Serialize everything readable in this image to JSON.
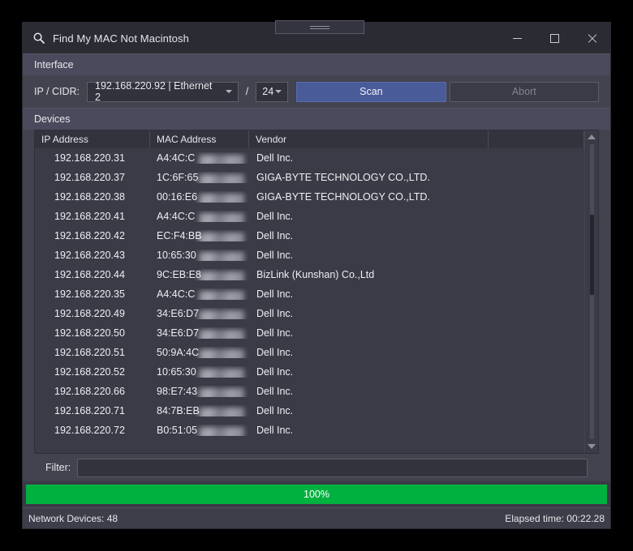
{
  "window": {
    "title": "Find My MAC Not Macintosh",
    "title_icon": "magnifier-icon",
    "minimize_label": "Minimize",
    "maximize_label": "Maximize",
    "close_label": "Close"
  },
  "interface_group": {
    "header": "Interface",
    "ip_cidr_label": "IP / CIDR:",
    "ip_value": "192.168.220.92 | Ethernet 2",
    "separator": "/",
    "cidr_value": "24",
    "scan_label": "Scan",
    "abort_label": "Abort",
    "scan_color": "#4a5b99",
    "abort_enabled": false
  },
  "devices_group": {
    "header": "Devices",
    "columns": [
      "IP Address",
      "MAC Address",
      "Vendor",
      ""
    ],
    "rows": [
      {
        "ip": "192.168.220.31",
        "mac": "A4:4C:C",
        "vendor": "Dell Inc."
      },
      {
        "ip": "192.168.220.37",
        "mac": "1C:6F:65",
        "vendor": "GIGA-BYTE TECHNOLOGY CO.,LTD."
      },
      {
        "ip": "192.168.220.38",
        "mac": "00:16:E6",
        "vendor": "GIGA-BYTE TECHNOLOGY CO.,LTD."
      },
      {
        "ip": "192.168.220.41",
        "mac": "A4:4C:C",
        "vendor": "Dell Inc."
      },
      {
        "ip": "192.168.220.42",
        "mac": "EC:F4:BB",
        "vendor": "Dell Inc."
      },
      {
        "ip": "192.168.220.43",
        "mac": "10:65:30",
        "vendor": "Dell Inc."
      },
      {
        "ip": "192.168.220.44",
        "mac": "9C:EB:E8",
        "vendor": "BizLink (Kunshan) Co.,Ltd"
      },
      {
        "ip": "192.168.220.35",
        "mac": "A4:4C:C",
        "vendor": "Dell Inc."
      },
      {
        "ip": "192.168.220.49",
        "mac": "34:E6:D7",
        "vendor": "Dell Inc."
      },
      {
        "ip": "192.168.220.50",
        "mac": "34:E6:D7",
        "vendor": "Dell Inc."
      },
      {
        "ip": "192.168.220.51",
        "mac": "50:9A:4C",
        "vendor": "Dell Inc."
      },
      {
        "ip": "192.168.220.52",
        "mac": "10:65:30",
        "vendor": "Dell Inc."
      },
      {
        "ip": "192.168.220.66",
        "mac": "98:E7:43",
        "vendor": "Dell Inc."
      },
      {
        "ip": "192.168.220.71",
        "mac": "84:7B:EB",
        "vendor": "Dell Inc."
      },
      {
        "ip": "192.168.220.72",
        "mac": "B0:51:05",
        "vendor": "Dell Inc."
      }
    ],
    "scrollbar": {
      "thumb_top_pct": 24,
      "thumb_height_pct": 27
    }
  },
  "filter": {
    "label": "Filter:",
    "value": "",
    "placeholder": ""
  },
  "progress": {
    "percent_label": "100%",
    "percent": 100,
    "color": "#00b140"
  },
  "status": {
    "devices": "Network Devices: 48",
    "elapsed": "Elapsed time: 00:22.28"
  }
}
